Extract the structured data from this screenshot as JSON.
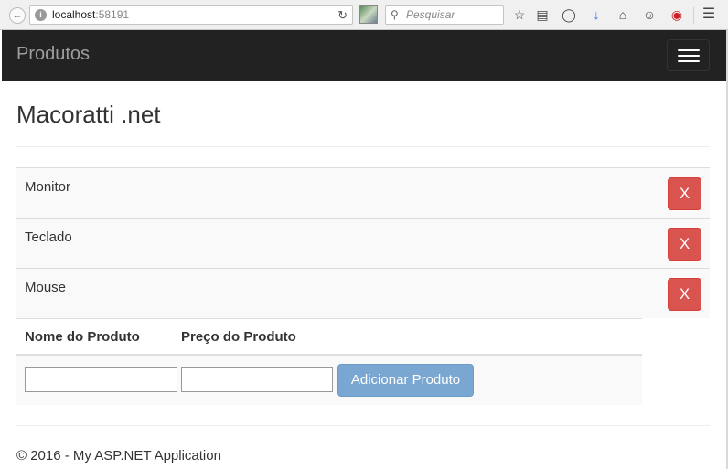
{
  "browser": {
    "url_host": "localhost",
    "url_port": ":58191",
    "search_placeholder": "Pesquisar"
  },
  "navbar": {
    "brand": "Produtos"
  },
  "page": {
    "title": "Macoratti .net"
  },
  "products": [
    {
      "name": "Monitor",
      "delete_label": "X"
    },
    {
      "name": "Teclado",
      "delete_label": "X"
    },
    {
      "name": "Mouse",
      "delete_label": "X"
    }
  ],
  "form": {
    "col_name": "Nome do Produto",
    "col_price": "Preço do Produto",
    "name_value": "",
    "price_value": "",
    "add_label": "Adicionar Produto"
  },
  "footer": {
    "text": "© 2016 - My ASP.NET Application"
  },
  "colors": {
    "navbar_bg": "#222222",
    "danger": "#d9534f",
    "primary_disabled": "#7aa7d1"
  }
}
